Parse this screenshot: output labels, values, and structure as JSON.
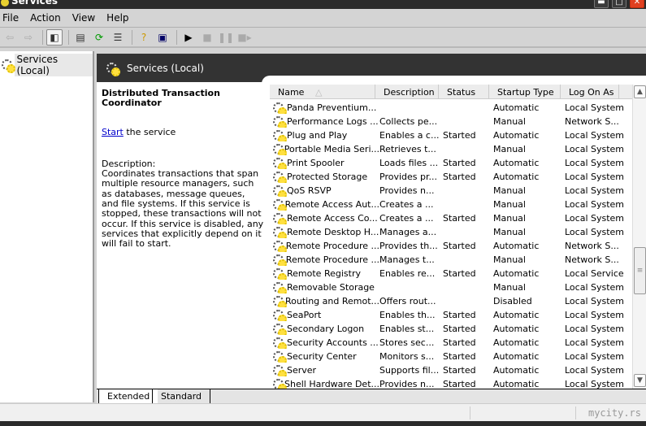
{
  "window": {
    "title": "Services",
    "minimize": "▬",
    "maximize": "□",
    "close": "✕"
  },
  "menu": [
    "File",
    "Action",
    "View",
    "Help"
  ],
  "tree": {
    "root": "Services (Local)"
  },
  "header": {
    "title": "Services (Local)"
  },
  "details": {
    "service_name": "Distributed Transaction Coordinator",
    "start_link": "Start",
    "start_suffix": " the service",
    "description_label": "Description:",
    "description": "Coordinates transactions that span multiple resource managers, such as databases, message queues, and file systems. If this service is stopped, these transactions will not occur. If this service is disabled, any services that explicitly depend on it will fail to start."
  },
  "columns": [
    "Name",
    "Description",
    "Status",
    "Startup Type",
    "Log On As"
  ],
  "rows": [
    [
      "Panda Preventium...",
      "",
      "",
      "Automatic",
      "Local System"
    ],
    [
      "Performance Logs ...",
      "Collects pe...",
      "",
      "Manual",
      "Network S..."
    ],
    [
      "Plug and Play",
      "Enables a c...",
      "Started",
      "Automatic",
      "Local System"
    ],
    [
      "Portable Media Seri...",
      "Retrieves t...",
      "",
      "Manual",
      "Local System"
    ],
    [
      "Print Spooler",
      "Loads files ...",
      "Started",
      "Automatic",
      "Local System"
    ],
    [
      "Protected Storage",
      "Provides pr...",
      "Started",
      "Automatic",
      "Local System"
    ],
    [
      "QoS RSVP",
      "Provides n...",
      "",
      "Manual",
      "Local System"
    ],
    [
      "Remote Access Aut...",
      "Creates a ...",
      "",
      "Manual",
      "Local System"
    ],
    [
      "Remote Access Co...",
      "Creates a ...",
      "Started",
      "Manual",
      "Local System"
    ],
    [
      "Remote Desktop H...",
      "Manages a...",
      "",
      "Manual",
      "Local System"
    ],
    [
      "Remote Procedure ...",
      "Provides th...",
      "Started",
      "Automatic",
      "Network S..."
    ],
    [
      "Remote Procedure ...",
      "Manages t...",
      "",
      "Manual",
      "Network S..."
    ],
    [
      "Remote Registry",
      "Enables re...",
      "Started",
      "Automatic",
      "Local Service"
    ],
    [
      "Removable Storage",
      "",
      "",
      "Manual",
      "Local System"
    ],
    [
      "Routing and Remot...",
      "Offers rout...",
      "",
      "Disabled",
      "Local System"
    ],
    [
      "SeaPort",
      "Enables th...",
      "Started",
      "Automatic",
      "Local System"
    ],
    [
      "Secondary Logon",
      "Enables st...",
      "Started",
      "Automatic",
      "Local System"
    ],
    [
      "Security Accounts ...",
      "Stores sec...",
      "Started",
      "Automatic",
      "Local System"
    ],
    [
      "Security Center",
      "Monitors s...",
      "Started",
      "Automatic",
      "Local System"
    ],
    [
      "Server",
      "Supports fil...",
      "Started",
      "Automatic",
      "Local System"
    ],
    [
      "Shell Hardware Det...",
      "Provides n...",
      "Started",
      "Automatic",
      "Local System"
    ]
  ],
  "tabs": [
    "Extended",
    "Standard"
  ],
  "status": {
    "watermark": "mycity.rs"
  }
}
